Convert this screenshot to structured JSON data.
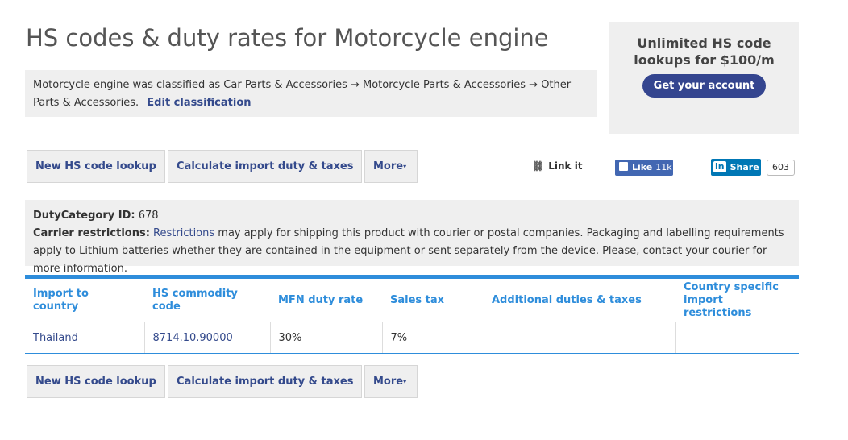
{
  "title": "HS codes & duty rates for Motorcycle engine",
  "classification": {
    "text": "Motorcycle engine was classified as Car Parts & Accessories → Motorcycle Parts & Accessories → Other Parts & Accessories.",
    "edit_link": "Edit classification"
  },
  "promo": {
    "text": "Unlimited HS code lookups for $100/m",
    "button": "Get your account"
  },
  "actions": {
    "new_lookup": "New HS code lookup",
    "calculate": "Calculate import duty & taxes",
    "more": "More",
    "more_caret": "▾"
  },
  "share": {
    "link_it": "Link it",
    "fb_like": "Like",
    "fb_count": "11k",
    "li_share": "Share",
    "li_brand": "in",
    "li_count": "603",
    "fb_color": "#4267b2",
    "li_color": "#0077b5"
  },
  "info": {
    "duty_category_label": "DutyCategory ID:",
    "duty_category_value": "678",
    "carrier_label": "Carrier restrictions:",
    "restrictions_link": "Restrictions",
    "carrier_text": "may apply for shipping this product with courier or postal companies. Packaging and labelling requirements apply to Lithium batteries whether they are contained in the equipment or sent separately from the device. Please, contact your courier for more information."
  },
  "table": {
    "headers": [
      "Import to country",
      "HS commodity code",
      "MFN duty rate",
      "Sales tax",
      "Additional duties & taxes",
      "Country specific import restrictions"
    ],
    "rows": [
      [
        "Thailand",
        "8714.10.90000",
        "30%",
        "7%",
        "",
        ""
      ]
    ]
  },
  "colors": {
    "accent": "#2e8ddb",
    "link": "#344a8c",
    "promo_button": "#34458f"
  }
}
